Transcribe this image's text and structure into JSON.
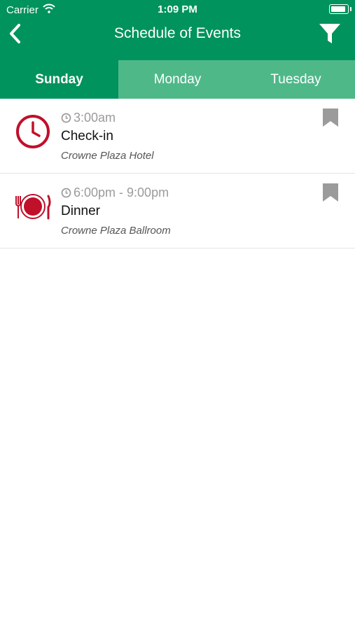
{
  "status_bar": {
    "carrier": "Carrier",
    "time": "1:09 PM",
    "battery_level": 1.0
  },
  "nav": {
    "title": "Schedule of Events",
    "back_icon": "chevron-left-icon",
    "filter_icon": "filter-icon"
  },
  "tabs": [
    {
      "label": "Sunday",
      "active": true
    },
    {
      "label": "Monday",
      "active": false
    },
    {
      "label": "Tuesday",
      "active": false
    }
  ],
  "events": [
    {
      "time": "3:00am",
      "name": "Check-in",
      "location": "Crowne Plaza Hotel",
      "icon": "clock-icon",
      "bookmarked": false
    },
    {
      "time": "6:00pm - 9:00pm",
      "name": "Dinner",
      "location": "Crowne Plaza Ballroom",
      "icon": "dinner-plate-icon",
      "bookmarked": false
    }
  ],
  "colors": {
    "header": "#00935d",
    "tab_inactive": "#4fb889",
    "event_icon": "#c0102a",
    "muted": "#9b9b9b"
  }
}
